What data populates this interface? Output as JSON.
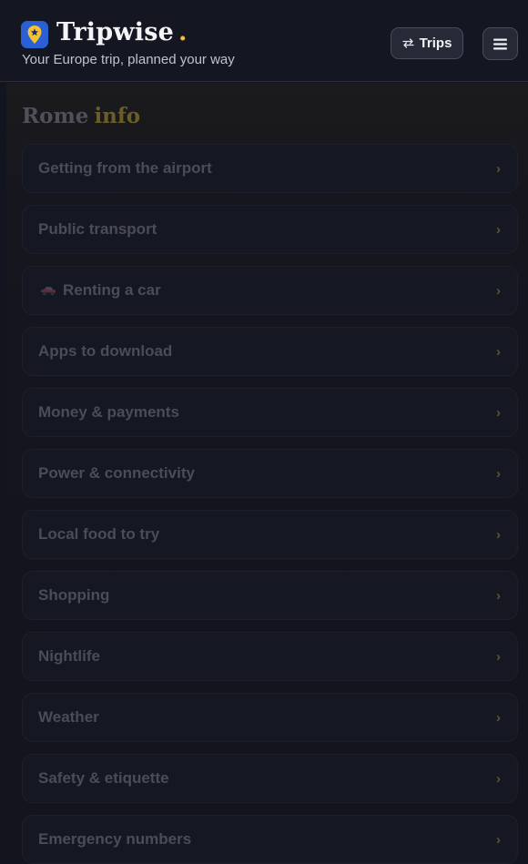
{
  "header": {
    "brand": "Tripwise",
    "brand_dot": ".",
    "tagline": "Your Europe trip, planned your way",
    "trips_label": "Trips",
    "logo_icon": "map-pin-star-icon",
    "trips_icon": "swap-arrows-icon",
    "menu_icon": "hamburger-menu-icon"
  },
  "section": {
    "city": "Rome",
    "title_accent": "info"
  },
  "colors": {
    "background": "#12141f",
    "accent_gold": "#f2c230",
    "logo_blue": "#2b5fd6"
  },
  "rows": [
    {
      "label": "Getting from the airport"
    },
    {
      "label": "Public transport"
    },
    {
      "label": "Renting a car",
      "icon": "car-icon"
    },
    {
      "label": "Apps to download"
    },
    {
      "label": "Money & payments"
    },
    {
      "label": "Power & connectivity"
    },
    {
      "label": "Local food to try"
    },
    {
      "label": "Shopping"
    },
    {
      "label": "Nightlife"
    },
    {
      "label": "Weather"
    },
    {
      "label": "Safety & etiquette"
    },
    {
      "label": "Emergency numbers"
    }
  ],
  "chevron": "›"
}
